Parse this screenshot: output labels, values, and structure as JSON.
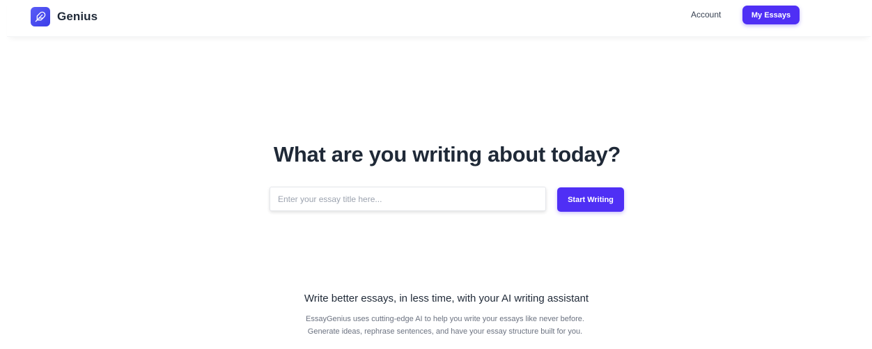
{
  "header": {
    "brand": "Genius",
    "logo_icon": "feather-icon",
    "account_label": "Account",
    "my_essays_label": "My Essays"
  },
  "hero": {
    "title": "What are you writing about today?",
    "input_placeholder": "Enter your essay title here...",
    "input_value": "",
    "start_button_label": "Start Writing"
  },
  "info": {
    "heading": "Write better essays, in less time, with your AI writing assistant",
    "description": "EssayGenius uses cutting-edge AI to help you write your essays like never before. Generate ideas, rephrase sentences, and have your essay structure built for you."
  },
  "colors": {
    "accent": "#4f2ff5",
    "logo_gradient_start": "#5a5cf7",
    "logo_gradient_end": "#3b3ee8",
    "text_dark": "#1f2937",
    "text_muted": "#6b7280"
  }
}
